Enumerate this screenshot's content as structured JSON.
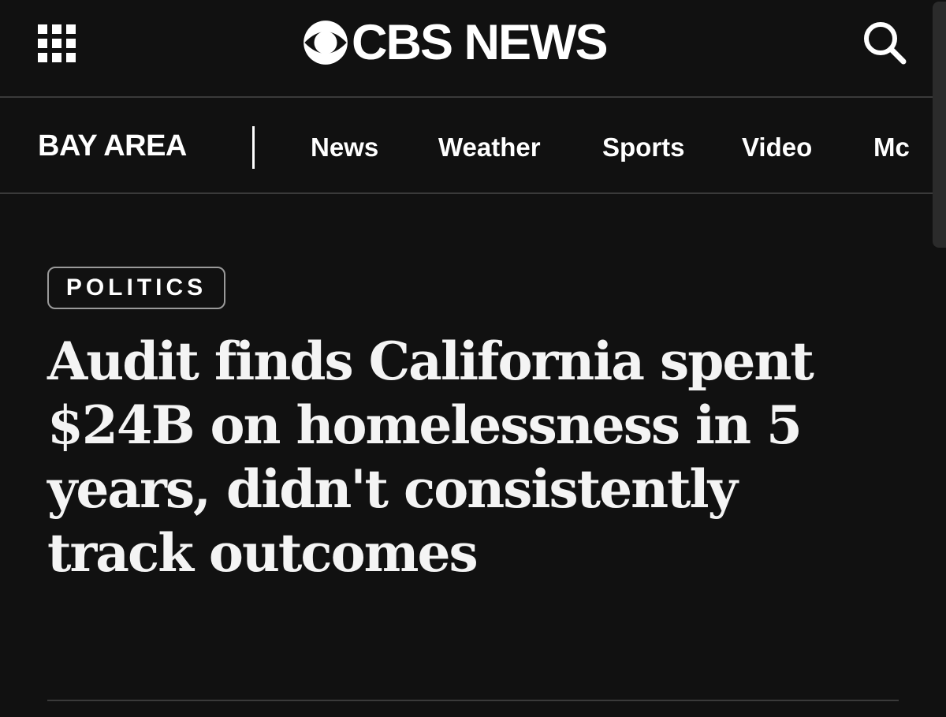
{
  "header": {
    "menu_icon": "grid-menu-icon",
    "logo_icon": "cbs-eye-icon",
    "logo_text": "CBS NEWS",
    "search_icon": "search-icon"
  },
  "section_nav": {
    "title": "BAY AREA",
    "items": [
      {
        "label": "News"
      },
      {
        "label": "Weather"
      },
      {
        "label": "Sports"
      },
      {
        "label": "Video"
      },
      {
        "label": "Mc"
      }
    ]
  },
  "article": {
    "category": "POLITICS",
    "headline": "Audit finds California spent $24B on homelessness in 5 years, didn't consistently track outcomes"
  },
  "colors": {
    "background": "#111111",
    "text": "#ffffff",
    "divider": "#3a3a3a"
  }
}
